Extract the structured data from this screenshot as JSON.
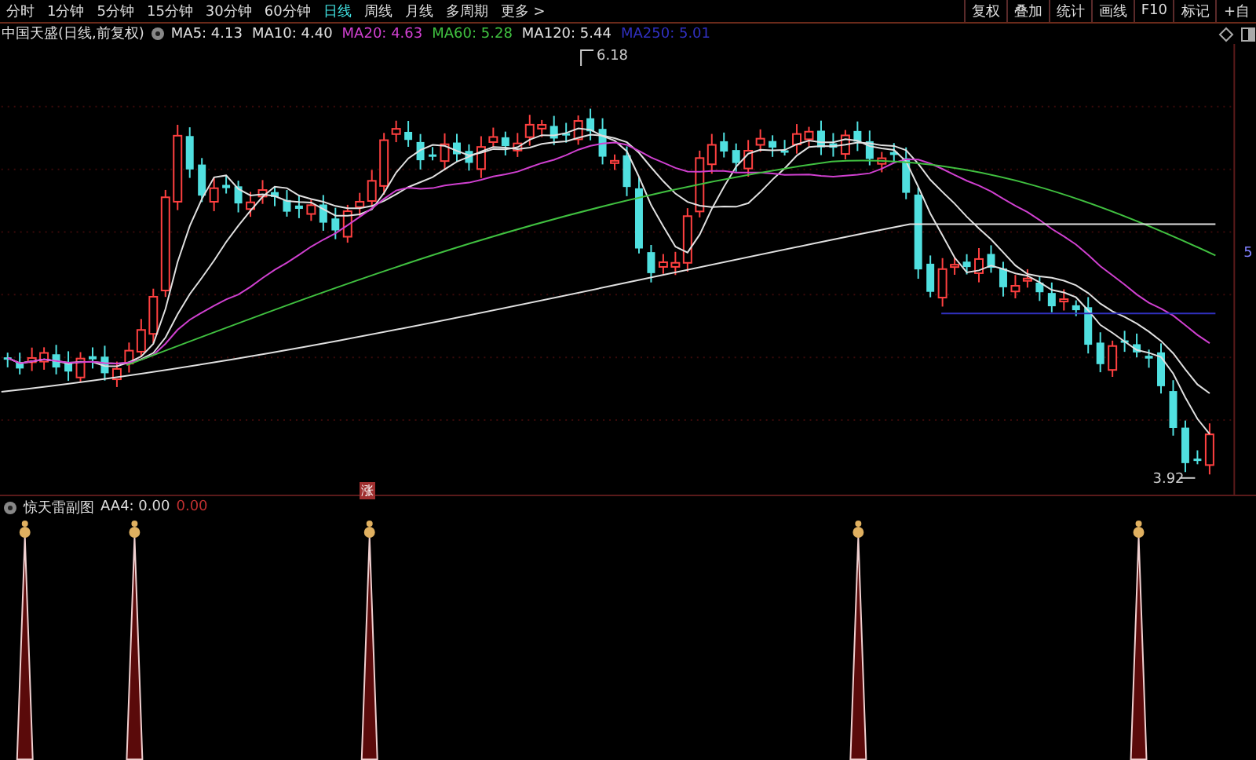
{
  "period_tabs": [
    {
      "label": "分时",
      "selected": false
    },
    {
      "label": "1分钟",
      "selected": false
    },
    {
      "label": "5分钟",
      "selected": false
    },
    {
      "label": "15分钟",
      "selected": false
    },
    {
      "label": "30分钟",
      "selected": false
    },
    {
      "label": "60分钟",
      "selected": false
    },
    {
      "label": "日线",
      "selected": true
    },
    {
      "label": "周线",
      "selected": false
    },
    {
      "label": "月线",
      "selected": false
    },
    {
      "label": "多周期",
      "selected": false
    },
    {
      "label": "更多 >",
      "selected": false
    }
  ],
  "toolbar_buttons": [
    "复权",
    "叠加",
    "统计",
    "画线",
    "F10",
    "标记",
    "+自"
  ],
  "main_chart": {
    "title": "中国天盛(日线,前复权)",
    "moving_averages": [
      {
        "label": "MA5: 4.13",
        "color": "#e0e0e0"
      },
      {
        "label": "MA10: 4.40",
        "color": "#e0e0e0"
      },
      {
        "label": "MA20: 4.63",
        "color": "#d040d0"
      },
      {
        "label": "MA60: 5.28",
        "color": "#40c040"
      },
      {
        "label": "MA120: 5.44",
        "color": "#e0e0e0"
      },
      {
        "label": "MA250: 5.01",
        "color": "#3030c0"
      }
    ],
    "high_label": "6.18",
    "low_label": "3.92",
    "axis_label": "5"
  },
  "sub_chart": {
    "title": "惊天雷副图",
    "value": "AA4: 0.00",
    "value_2": "0.00",
    "marker": "涨"
  }
}
